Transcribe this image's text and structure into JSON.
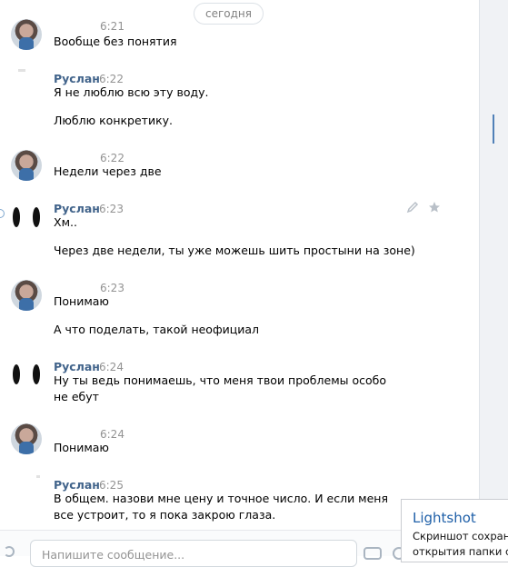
{
  "date_divider": "сегодня",
  "messages": [
    {
      "author": "",
      "time": "6:21",
      "lines": [
        "Вообще без понятия"
      ]
    },
    {
      "author": "Руслан",
      "time": "6:22",
      "lines": [
        "Я не люблю всю эту воду.",
        "Люблю конкретику."
      ]
    },
    {
      "author": "",
      "time": "6:22",
      "lines": [
        "Недели через две"
      ]
    },
    {
      "author": "Руслан",
      "time": "6:23",
      "lines": [
        "Хм..",
        "Через две недели, ты уже можешь шить простыни на зоне)"
      ]
    },
    {
      "author": "",
      "time": "6:23",
      "lines": [
        "Понимаю",
        "А что поделать, такой неофициал"
      ]
    },
    {
      "author": "Руслан",
      "time": "6:24",
      "lines": [
        "Ну ты ведь понимаешь, что меня твои проблемы особо не ебут"
      ]
    },
    {
      "author": "",
      "time": "6:24",
      "lines": [
        "Понимаю"
      ]
    },
    {
      "author": "Руслан",
      "time": "6:25",
      "lines": [
        "В общем. назови мне цену и точное число. И если меня все устроит, то я пока закрою глаза."
      ]
    }
  ],
  "composer": {
    "placeholder": "Напишите сообщение..."
  },
  "toast": {
    "title": "Lightshot",
    "line1": "Скриншот сохранё",
    "line2": "открытия папки со"
  },
  "icons": {
    "edit": "pencil-icon",
    "favorite": "star-icon",
    "attach": "paperclip-icon",
    "camera": "camera-icon",
    "emoji": "emoji-icon"
  }
}
